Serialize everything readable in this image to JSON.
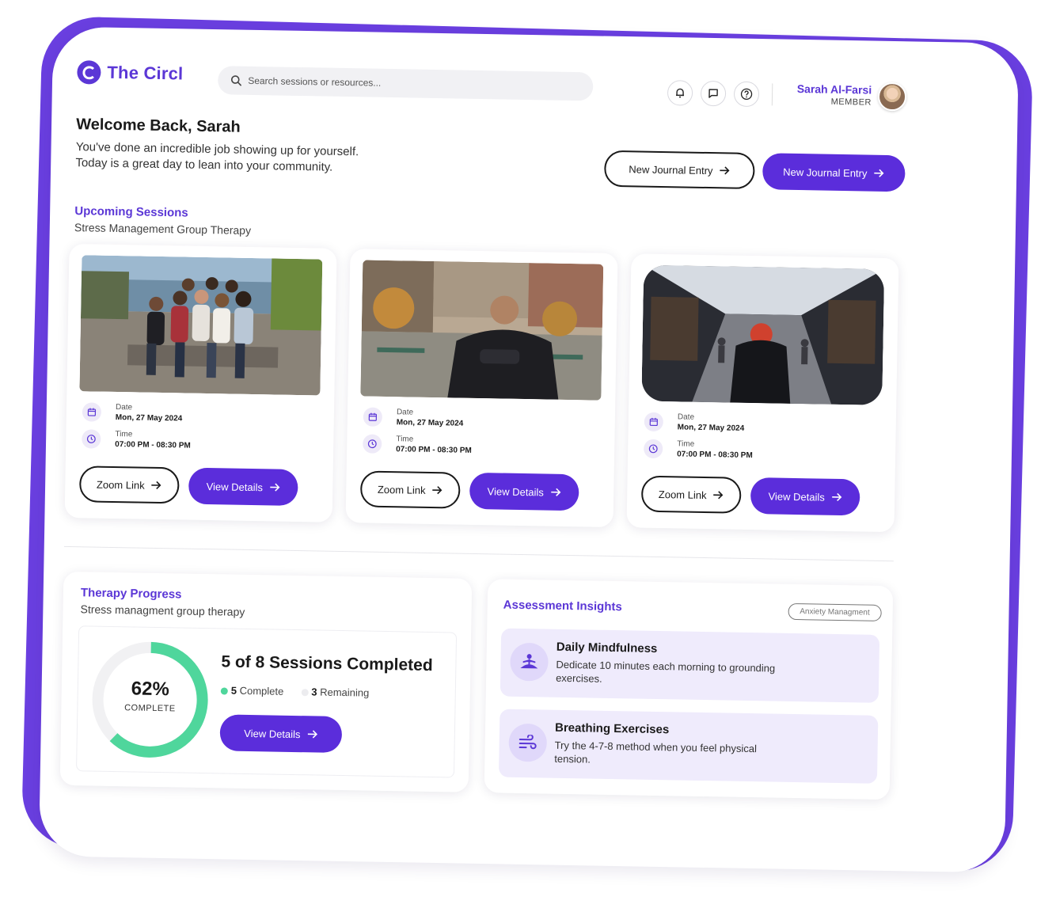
{
  "app": {
    "name": "The Circl"
  },
  "search": {
    "placeholder": "Search sessions or resources..."
  },
  "header": {
    "icons": [
      "bell-icon",
      "chat-icon",
      "help-icon"
    ],
    "user_name": "Sarah Al-Farsi",
    "user_role": "MEMBER"
  },
  "welcome": {
    "title": "Welcome Back, Sarah",
    "line1": "You've done an incredible job showing up for yourself.",
    "line2": "Today is a great day to lean into your community.",
    "btn_outline": "New Journal Entry",
    "btn_solid": "New Journal Entry"
  },
  "upcoming": {
    "title": "Upcoming Sessions",
    "subtitle": "Stress Management Group Therapy",
    "cards": [
      {
        "date_label": "Date",
        "date": "Mon, 27 May 2024",
        "time_label": "Time",
        "time": "07:00 PM - 08:30 PM",
        "zoom_label": "Zoom Link",
        "details_label": "View Details"
      },
      {
        "date_label": "Date",
        "date": "Mon, 27 May 2024",
        "time_label": "Time",
        "time": "07:00 PM - 08:30 PM",
        "zoom_label": "Zoom Link",
        "details_label": "View Details"
      },
      {
        "date_label": "Date",
        "date": "Mon, 27 May 2024",
        "time_label": "Time",
        "time": "07:00 PM - 08:30 PM",
        "zoom_label": "Zoom Link",
        "details_label": "View Details"
      }
    ]
  },
  "progress": {
    "title": "Therapy Progress",
    "subtitle": "Stress managment group therapy",
    "percent_value": 62,
    "percent": "62%",
    "percent_label": "COMPLETE",
    "headline": "5 of 8 Sessions Completed",
    "complete_count": "5",
    "complete_label": "Complete",
    "remaining_count": "3",
    "remaining_label": "Remaining",
    "button": "View Details"
  },
  "assessment": {
    "title": "Assessment Insights",
    "tag": "Anxiety Managment",
    "items": [
      {
        "icon": "meditation-icon",
        "title": "Daily Mindfulness",
        "text": "Dedicate 10 minutes each morning to grounding exercises."
      },
      {
        "icon": "wind-icon",
        "title": "Breathing Exercises",
        "text": "Try the 4-7-8 method when you feel physical tension."
      }
    ]
  },
  "colors": {
    "brand": "#5b2ddb",
    "accent_green": "#4fd69c",
    "lavender": "#efebfc"
  }
}
